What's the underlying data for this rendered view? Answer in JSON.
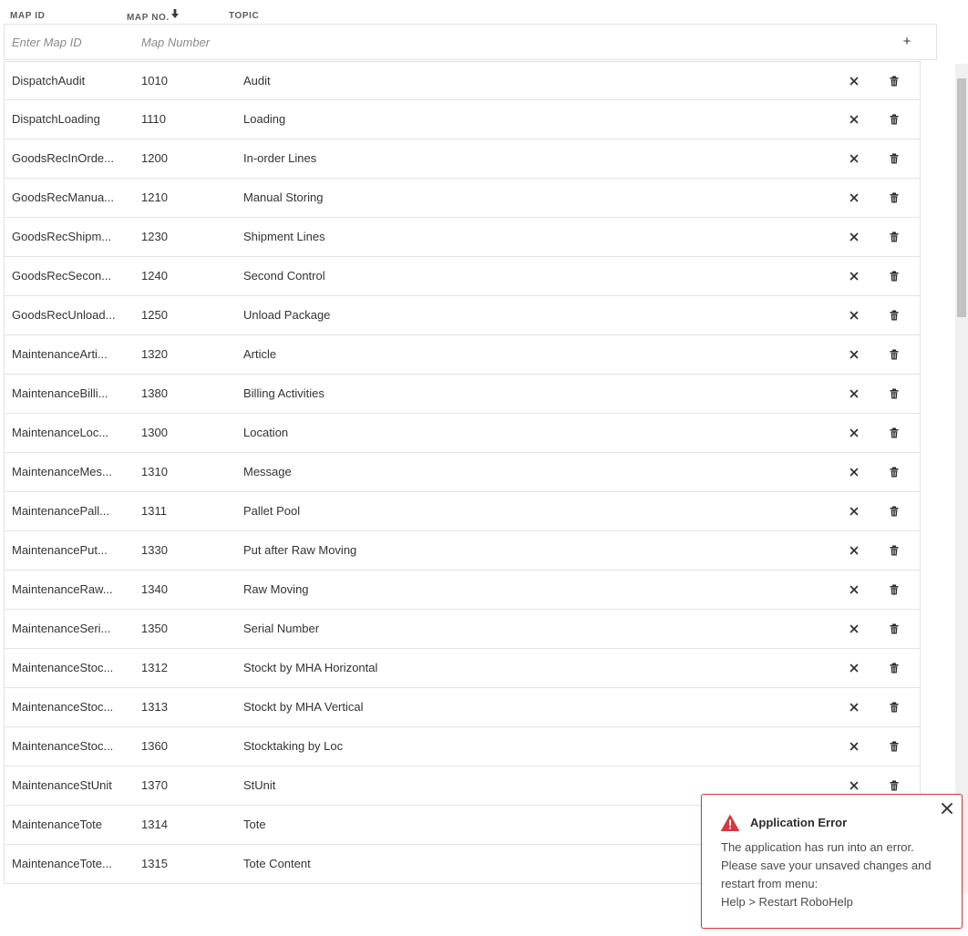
{
  "columns": {
    "map_id": "MAP ID",
    "map_no": "MAP NO.",
    "topic": "TOPIC",
    "sort_icon": "arrow-down-icon"
  },
  "new_row": {
    "map_id_placeholder": "Enter Map ID",
    "map_no_placeholder": "Map Number",
    "add_label": "+"
  },
  "rows": [
    {
      "map_id": "DispatchAudit",
      "map_no": "1010",
      "topic": "Audit"
    },
    {
      "map_id": "DispatchLoading",
      "map_no": "1110",
      "topic": "Loading"
    },
    {
      "map_id": "GoodsRecInOrde...",
      "map_no": "1200",
      "topic": "In-order Lines"
    },
    {
      "map_id": "GoodsRecManua...",
      "map_no": "1210",
      "topic": "Manual Storing"
    },
    {
      "map_id": "GoodsRecShipm...",
      "map_no": "1230",
      "topic": "Shipment Lines"
    },
    {
      "map_id": "GoodsRecSecon...",
      "map_no": "1240",
      "topic": "Second Control"
    },
    {
      "map_id": "GoodsRecUnload...",
      "map_no": "1250",
      "topic": "Unload Package"
    },
    {
      "map_id": "MaintenanceArti...",
      "map_no": "1320",
      "topic": "Article"
    },
    {
      "map_id": "MaintenanceBilli...",
      "map_no": "1380",
      "topic": "Billing Activities"
    },
    {
      "map_id": "MaintenanceLoc...",
      "map_no": "1300",
      "topic": "Location"
    },
    {
      "map_id": "MaintenanceMes...",
      "map_no": "1310",
      "topic": "Message"
    },
    {
      "map_id": "MaintenancePall...",
      "map_no": "1311",
      "topic": "Pallet Pool"
    },
    {
      "map_id": "MaintenancePut...",
      "map_no": "1330",
      "topic": "Put after Raw Moving"
    },
    {
      "map_id": "MaintenanceRaw...",
      "map_no": "1340",
      "topic": "Raw Moving"
    },
    {
      "map_id": "MaintenanceSeri...",
      "map_no": "1350",
      "topic": "Serial Number"
    },
    {
      "map_id": "MaintenanceStoc...",
      "map_no": "1312",
      "topic": "Stockt by MHA Horizontal"
    },
    {
      "map_id": "MaintenanceStoc...",
      "map_no": "1313",
      "topic": "Stockt by MHA Vertical"
    },
    {
      "map_id": "MaintenanceStoc...",
      "map_no": "1360",
      "topic": "Stocktaking by Loc"
    },
    {
      "map_id": "MaintenanceStUnit",
      "map_no": "1370",
      "topic": "StUnit"
    },
    {
      "map_id": "MaintenanceTote",
      "map_no": "1314",
      "topic": "Tote"
    },
    {
      "map_id": "MaintenanceTote...",
      "map_no": "1315",
      "topic": "Tote Content"
    }
  ],
  "row_icons": {
    "remove": "close-icon",
    "delete": "trash-icon"
  },
  "error_toast": {
    "title": "Application Error",
    "line1": "The application has run into an error.",
    "line2": "Please save your unsaved changes and",
    "line3": "restart from menu:",
    "line4": "Help > Restart RoboHelp",
    "icon": "warning-icon",
    "border_color": "#d7373f"
  }
}
